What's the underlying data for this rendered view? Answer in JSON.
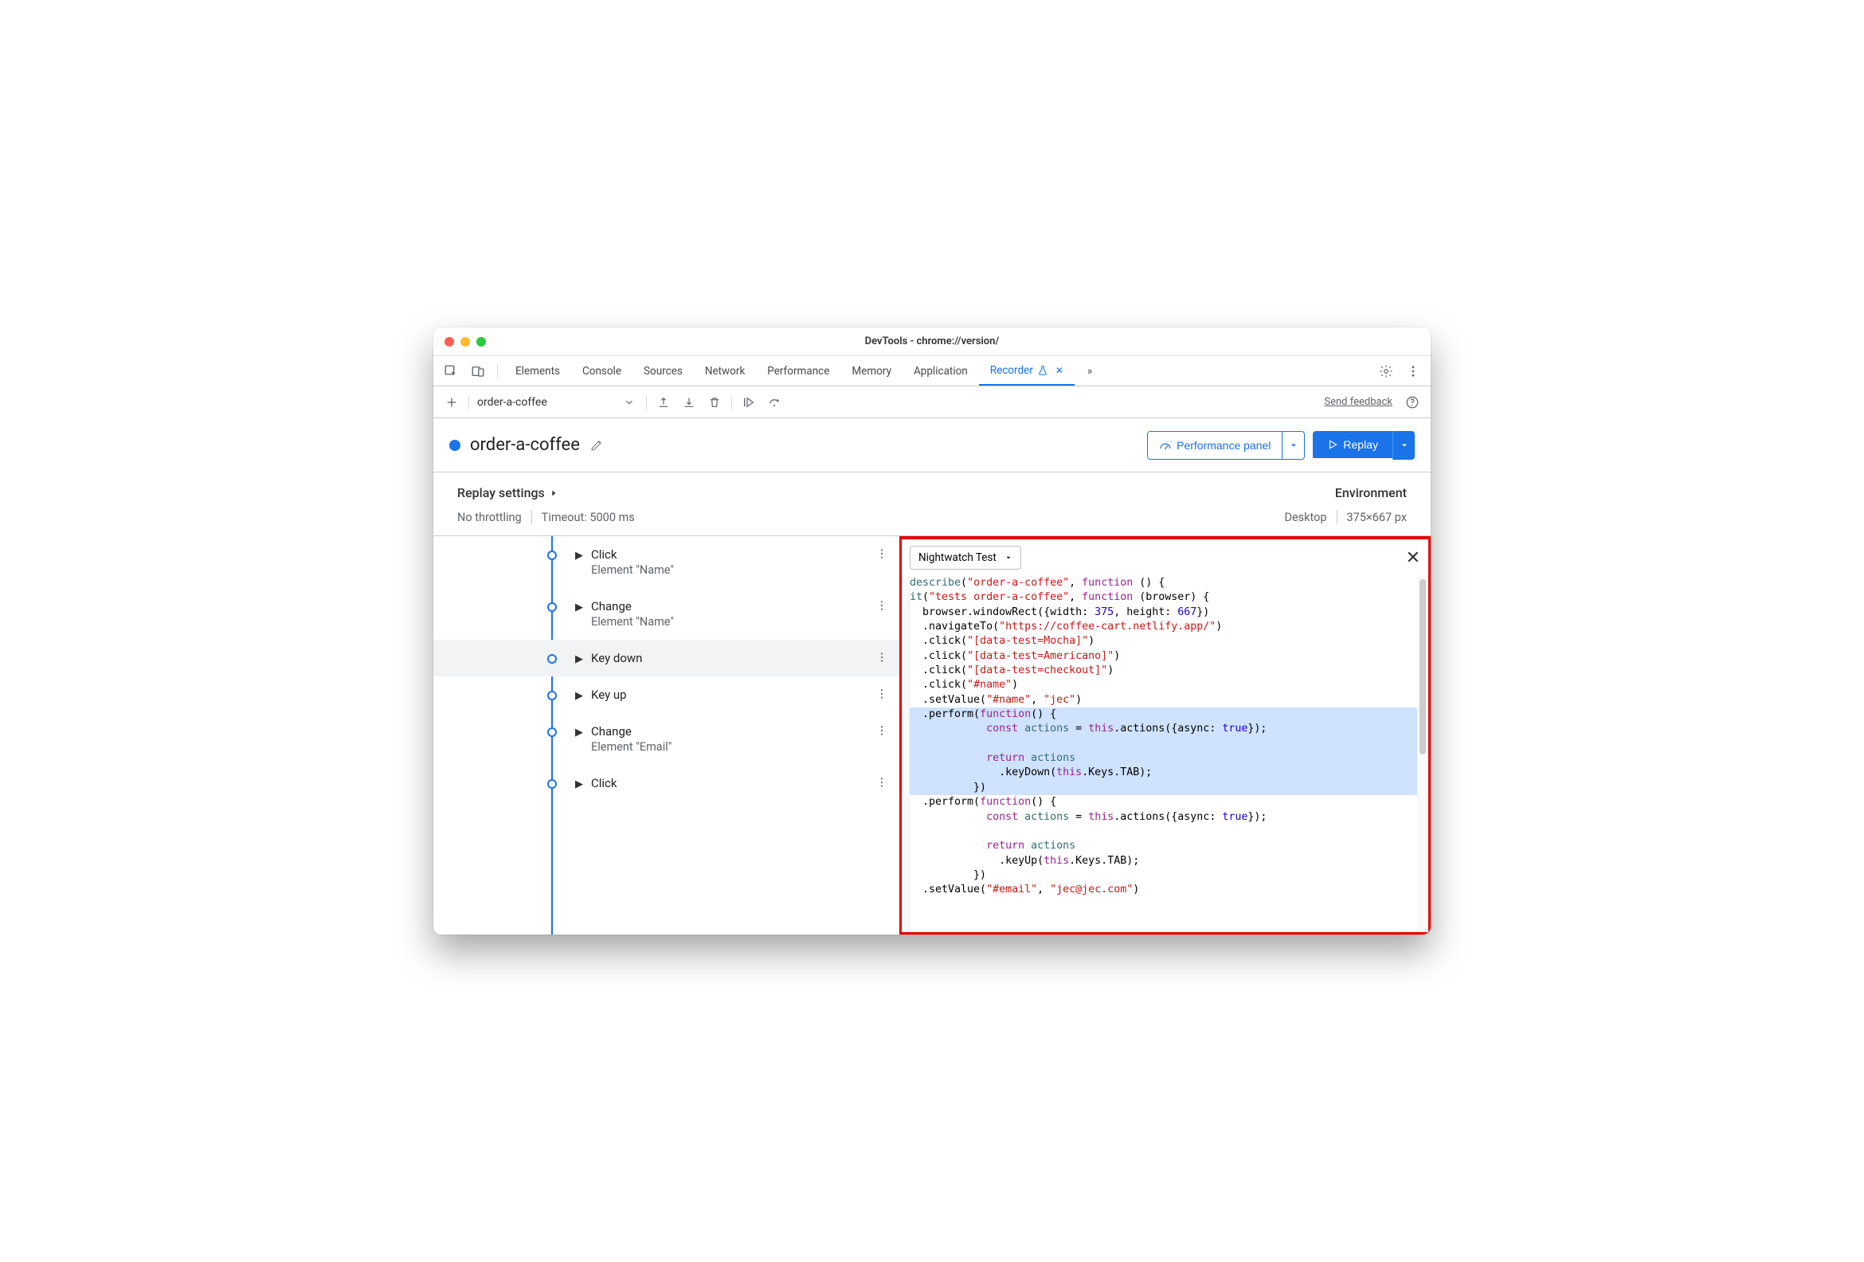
{
  "window_title": "DevTools - chrome://version/",
  "tabs": [
    "Elements",
    "Console",
    "Sources",
    "Network",
    "Performance",
    "Memory",
    "Application",
    "Recorder"
  ],
  "active_tab": "Recorder",
  "overflow_glyph": "»",
  "recording_name": "order-a-coffee",
  "send_feedback": "Send feedback",
  "header": {
    "title": "order-a-coffee",
    "performance_btn": "Performance panel",
    "replay_btn": "Replay"
  },
  "settings": {
    "label": "Replay settings",
    "env_label": "Environment",
    "throttling": "No throttling",
    "timeout": "Timeout: 5000 ms",
    "device": "Desktop",
    "dimensions": "375×667 px"
  },
  "steps": [
    {
      "name": "Click",
      "sub": "Element \"Name\""
    },
    {
      "name": "Change",
      "sub": "Element \"Name\""
    },
    {
      "name": "Key down",
      "sub": "",
      "selected": true
    },
    {
      "name": "Key up",
      "sub": ""
    },
    {
      "name": "Change",
      "sub": "Element \"Email\""
    },
    {
      "name": "Click",
      "sub": ""
    }
  ],
  "export": {
    "dropdown_label": "Nightwatch Test",
    "code_tokens": [
      [
        [
          "id",
          "describe"
        ],
        [
          "",
          "("
        ],
        [
          "str",
          "\"order-a-coffee\""
        ],
        [
          "",
          ", "
        ],
        [
          "kw",
          "function"
        ],
        [
          "",
          " () {"
        ]
      ],
      [
        [
          "id",
          "it"
        ],
        [
          "",
          "("
        ],
        [
          "str",
          "\"tests order-a-coffee\""
        ],
        [
          "",
          ", "
        ],
        [
          "kw",
          "function"
        ],
        [
          "",
          " (browser) {"
        ]
      ],
      [
        [
          "",
          "  browser.windowRect({width: "
        ],
        [
          "num",
          "375"
        ],
        [
          "",
          ", height: "
        ],
        [
          "num",
          "667"
        ],
        [
          "",
          "})"
        ]
      ],
      [
        [
          "",
          "  .navigateTo("
        ],
        [
          "str",
          "\"https://coffee-cart.netlify.app/\""
        ],
        [
          "",
          ")"
        ]
      ],
      [
        [
          "",
          "  .click("
        ],
        [
          "str",
          "\"[data-test=Mocha]\""
        ],
        [
          "",
          ")"
        ]
      ],
      [
        [
          "",
          "  .click("
        ],
        [
          "str",
          "\"[data-test=Americano]\""
        ],
        [
          "",
          ")"
        ]
      ],
      [
        [
          "",
          "  .click("
        ],
        [
          "str",
          "\"[data-test=checkout]\""
        ],
        [
          "",
          ")"
        ]
      ],
      [
        [
          "",
          "  .click("
        ],
        [
          "str",
          "\"#name\""
        ],
        [
          "",
          ")"
        ]
      ],
      [
        [
          "",
          "  .setValue("
        ],
        [
          "str",
          "\"#name\""
        ],
        [
          "",
          ", "
        ],
        [
          "str",
          "\"jec\""
        ],
        [
          "",
          ")"
        ]
      ],
      [
        [
          "hl",
          ""
        ],
        [
          "",
          "  .perform("
        ],
        [
          "kw",
          "function"
        ],
        [
          "",
          "() {"
        ]
      ],
      [
        [
          "hl",
          ""
        ],
        [
          "",
          "            "
        ],
        [
          "kw",
          "const"
        ],
        [
          "",
          " "
        ],
        [
          "id",
          "actions"
        ],
        [
          "",
          " = "
        ],
        [
          "kw",
          "this"
        ],
        [
          "",
          ".actions({async: "
        ],
        [
          "bool",
          "true"
        ],
        [
          "",
          "});"
        ]
      ],
      [
        [
          "hl",
          ""
        ],
        [
          "",
          ""
        ]
      ],
      [
        [
          "hl",
          ""
        ],
        [
          "",
          "            "
        ],
        [
          "kw",
          "return"
        ],
        [
          "",
          " "
        ],
        [
          "id",
          "actions"
        ]
      ],
      [
        [
          "hl",
          ""
        ],
        [
          "",
          "              .keyDown("
        ],
        [
          "kw",
          "this"
        ],
        [
          "",
          ".Keys.TAB);"
        ]
      ],
      [
        [
          "hl",
          ""
        ],
        [
          "",
          "          })"
        ]
      ],
      [
        [
          "",
          "  .perform("
        ],
        [
          "kw",
          "function"
        ],
        [
          "",
          "() {"
        ]
      ],
      [
        [
          "",
          "            "
        ],
        [
          "kw",
          "const"
        ],
        [
          "",
          " "
        ],
        [
          "id",
          "actions"
        ],
        [
          "",
          " = "
        ],
        [
          "kw",
          "this"
        ],
        [
          "",
          ".actions({async: "
        ],
        [
          "bool",
          "true"
        ],
        [
          "",
          "});"
        ]
      ],
      [
        [
          "",
          ""
        ]
      ],
      [
        [
          "",
          "            "
        ],
        [
          "kw",
          "return"
        ],
        [
          "",
          " "
        ],
        [
          "id",
          "actions"
        ]
      ],
      [
        [
          "",
          "              .keyUp("
        ],
        [
          "kw",
          "this"
        ],
        [
          "",
          ".Keys.TAB);"
        ]
      ],
      [
        [
          "",
          "          })"
        ]
      ],
      [
        [
          "",
          "  .setValue("
        ],
        [
          "str",
          "\"#email\""
        ],
        [
          "",
          ", "
        ],
        [
          "str",
          "\"jec@jec.com\""
        ],
        [
          "",
          ")"
        ]
      ]
    ]
  }
}
